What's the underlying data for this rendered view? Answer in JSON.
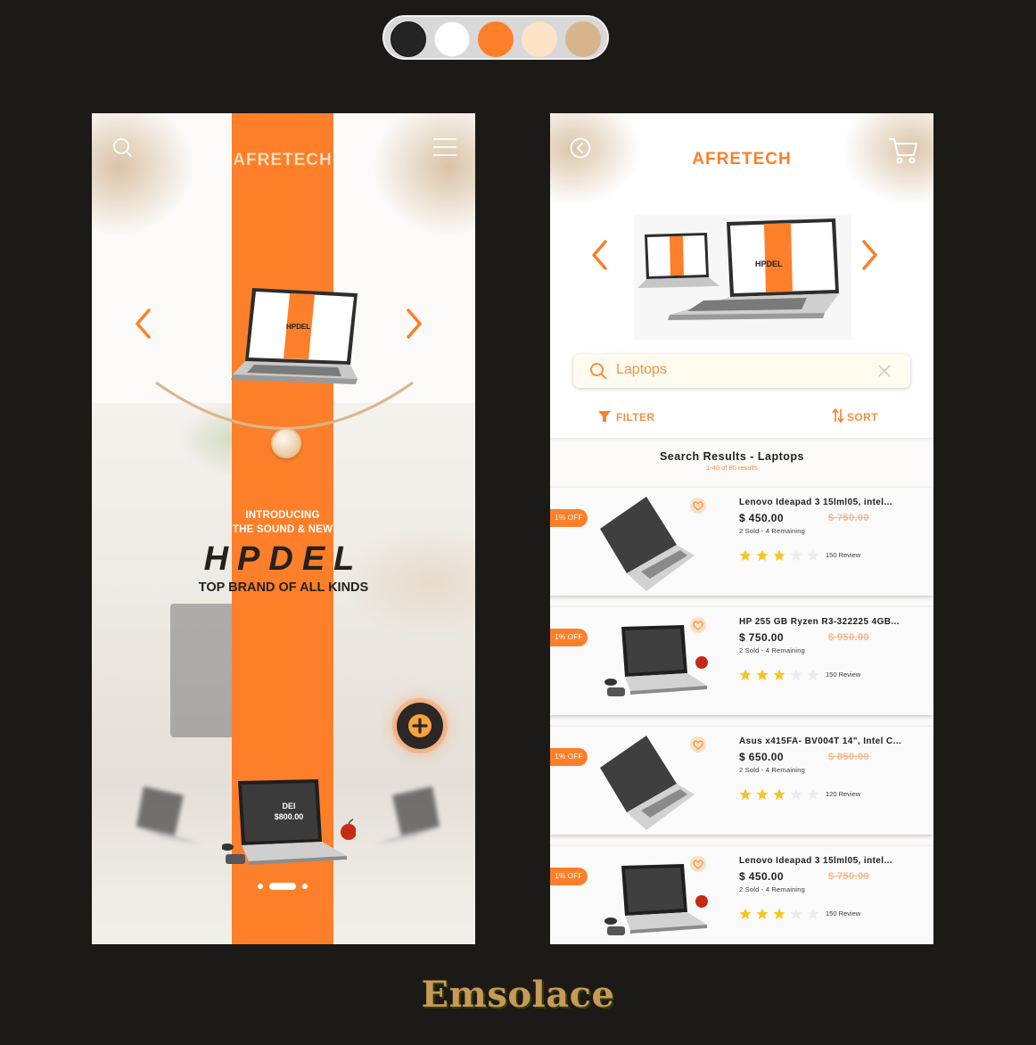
{
  "palette": {
    "colors": [
      "#242424",
      "#ffffff",
      "#fd7f2a",
      "#fde3c6",
      "#d8b48c"
    ]
  },
  "home": {
    "logo": "AFRETECH",
    "intro_line1": "INTRODUCING",
    "intro_line2": "THE SOUND & NEW",
    "headline": "HPDEL",
    "tagline": "TOP BRAND OF ALL KINDS",
    "featured_name": "DEI",
    "featured_price": "$800.00",
    "carousel_pages": 3,
    "carousel_active": 2,
    "icons": [
      "search-icon",
      "hamburger-menu-icon",
      "chevron-left-icon",
      "chevron-right-icon",
      "plus-icon"
    ]
  },
  "search_screen": {
    "logo": "AFRETECH",
    "search_value": "Laptops",
    "filter_label": "FILTER",
    "sort_label": "SORT",
    "results_title": "Search Results - Laptops",
    "results_count": "1-40 of 80 results",
    "icons": [
      "back-circle-icon",
      "cart-icon",
      "search-icon",
      "clear-icon",
      "filter-icon",
      "sort-icon",
      "heart-icon",
      "star-icon"
    ],
    "products": [
      {
        "discount": "1% OFF",
        "name": "Lenovo Ideapad 3 15lml05, intel...",
        "price": "$ 450.00",
        "old_price": "$ 750.00",
        "stock": "2 Sold - 4 Remaining",
        "rating": 3,
        "reviews": "150 Review"
      },
      {
        "discount": "1% OFF",
        "name": "HP 255 GB Ryzen R3-322225 4GB...",
        "price": "$ 750.00",
        "old_price": "$ 950.00",
        "stock": "2 Sold - 4 Remaining",
        "rating": 3,
        "reviews": "150 Review"
      },
      {
        "discount": "1% OFF",
        "name": "Asus x415FA- BV004T 14\", Intel C...",
        "price": "$ 650.00",
        "old_price": "$ 850.00",
        "stock": "2 Sold - 4 Remaining",
        "rating": 3,
        "reviews": "120 Review"
      },
      {
        "discount": "1% OFF",
        "name": "Lenovo Ideapad 3 15lml05, intel...",
        "price": "$ 450.00",
        "old_price": "$ 750.00",
        "stock": "2 Sold - 4 Remaining",
        "rating": 3,
        "reviews": "150 Review"
      }
    ]
  },
  "brand": "Emsolace"
}
